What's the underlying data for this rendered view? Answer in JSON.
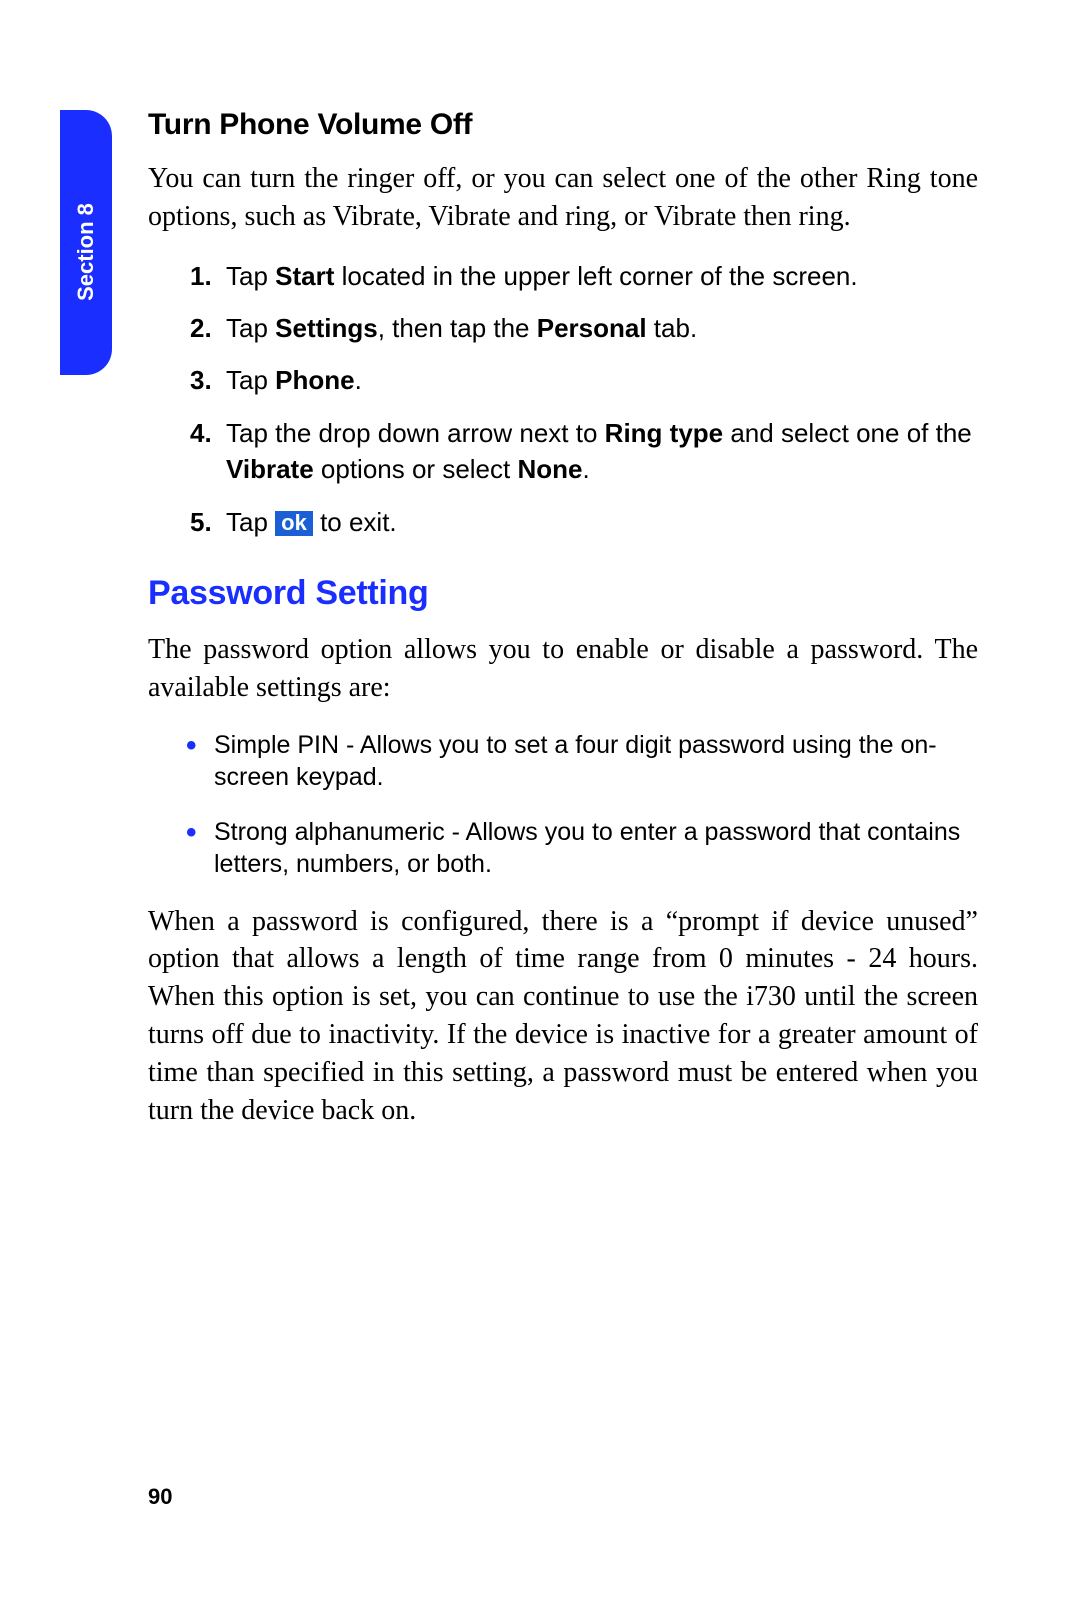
{
  "tab_label": "Section 8",
  "page_number": "90",
  "subheading_1": "Turn Phone Volume Off",
  "intro_paragraph": "You can turn the ringer off, or you can select one of the other Ring tone options, such as Vibrate, Vibrate and ring, or Vibrate then ring.",
  "steps": {
    "s1_a": "Tap ",
    "s1_b": "Start",
    "s1_c": " located in the upper left corner of the screen.",
    "s2_a": "Tap ",
    "s2_b": "Settings",
    "s2_c": ", then tap the ",
    "s2_d": "Personal",
    "s2_e": " tab.",
    "s3_a": "Tap ",
    "s3_b": "Phone",
    "s3_c": ".",
    "s4_a": "Tap the drop down arrow next to ",
    "s4_b": "Ring type",
    "s4_c": " and select one of the ",
    "s4_d": "Vibrate",
    "s4_e": " options or select ",
    "s4_f": "None",
    "s4_g": ".",
    "s5_a": "Tap ",
    "s5_ok": "ok",
    "s5_b": " to exit."
  },
  "section_heading": "Password Setting",
  "password_intro": "The password option allows you to enable or disable a password. The available settings are:",
  "bullets": {
    "b1": "Simple PIN - Allows you to set a four digit password using the on-screen keypad.",
    "b2": "Strong alphanumeric - Allows you to enter a password that contains letters, numbers, or both."
  },
  "password_detail": "When a password is configured, there is a “prompt if device unused” option that allows a length of time range from 0 minutes - 24 hours. When this option is set, you can continue to use the i730 until the screen turns off due to inactivity. If the device is inactive for a greater amount of time than specified in this setting, a password must be entered when you turn the device back on."
}
